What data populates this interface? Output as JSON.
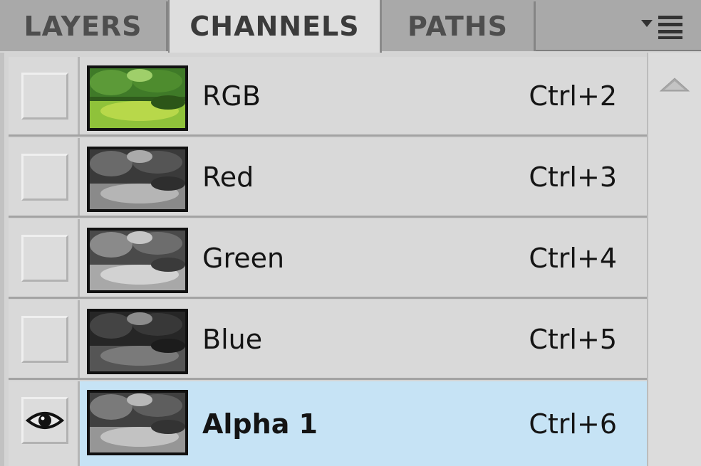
{
  "tabs": [
    {
      "label": "LAYERS",
      "active": false
    },
    {
      "label": "CHANNELS",
      "active": true
    },
    {
      "label": "PATHS",
      "active": false
    }
  ],
  "panel_menu_icon": "panel-menu-icon",
  "channels": [
    {
      "name": "RGB",
      "shortcut": "Ctrl+2",
      "visible": false,
      "selected": false,
      "thumbnail": "color"
    },
    {
      "name": "Red",
      "shortcut": "Ctrl+3",
      "visible": false,
      "selected": false,
      "thumbnail": "grayscale"
    },
    {
      "name": "Green",
      "shortcut": "Ctrl+4",
      "visible": false,
      "selected": false,
      "thumbnail": "grayscale"
    },
    {
      "name": "Blue",
      "shortcut": "Ctrl+5",
      "visible": false,
      "selected": false,
      "thumbnail": "grayscale"
    },
    {
      "name": "Alpha 1",
      "shortcut": "Ctrl+6",
      "visible": true,
      "selected": true,
      "thumbnail": "grayscale"
    }
  ],
  "colors": {
    "selected_row": "#c6e3f5",
    "row": "#d9d9d9",
    "tabbar": "#a9a9a9"
  }
}
